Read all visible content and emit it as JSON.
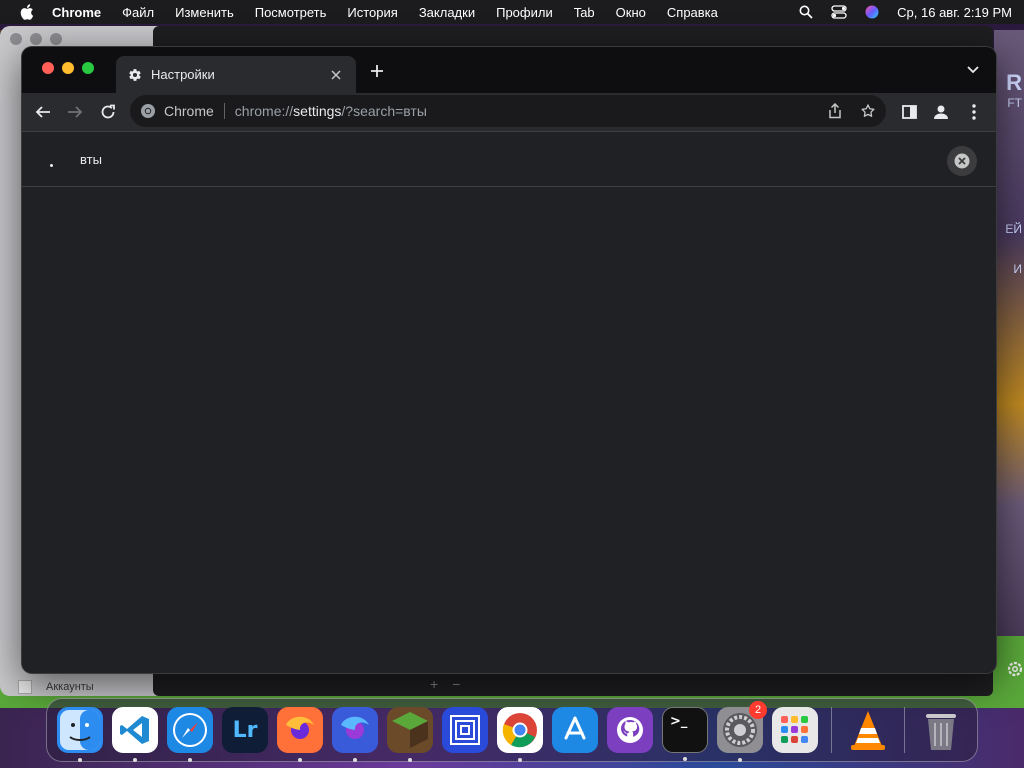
{
  "menubar": {
    "app": "Chrome",
    "items": [
      "Файл",
      "Изменить",
      "Посмотреть",
      "История",
      "Закладки",
      "Профили",
      "Tab",
      "Окно",
      "Справка"
    ],
    "clock": "Ср, 16 авг.  2:19 PM"
  },
  "background": {
    "status_text": "Аккаунты",
    "right_edge_texts": [
      "R",
      "FT",
      "ЕЙ",
      "И"
    ]
  },
  "chrome": {
    "tab": {
      "title": "Настройки",
      "icon": "gear-icon"
    },
    "omnibox": {
      "site_label": "Chrome",
      "url_prefix": "chrome://",
      "url_host": "settings",
      "url_suffix": "/?search=вты"
    },
    "settings_search": {
      "query": "вты"
    }
  },
  "dock": {
    "apps": [
      {
        "name": "finder",
        "label": "",
        "color": "#2d8cf0"
      },
      {
        "name": "vscode",
        "label": "",
        "color": "#ffffff"
      },
      {
        "name": "safari",
        "label": "",
        "color": "#1e88e5"
      },
      {
        "name": "lightroom",
        "label": "Lr",
        "color": "#0f1e36"
      },
      {
        "name": "firefox",
        "label": "",
        "color": "#ff7139"
      },
      {
        "name": "firefox-developer",
        "label": "",
        "color": "#3a5bd9"
      },
      {
        "name": "minecraft",
        "label": "",
        "color": "#6b4a2a"
      },
      {
        "name": "screen-app",
        "label": "",
        "color": "#2a4ad9"
      },
      {
        "name": "chrome",
        "label": "",
        "color": "#ffffff"
      },
      {
        "name": "app-store",
        "label": "",
        "color": "#1e88e5"
      },
      {
        "name": "github-desktop",
        "label": "",
        "color": "#7b3fbf"
      },
      {
        "name": "terminal",
        "label": ">_",
        "color": "#111111"
      },
      {
        "name": "system-settings",
        "label": "",
        "color": "#8e8e93",
        "badge": "2"
      },
      {
        "name": "launchpad",
        "label": "",
        "color": "#e8e8e8"
      },
      {
        "name": "vlc",
        "label": "",
        "color": "transparent"
      },
      {
        "name": "trash",
        "label": "",
        "color": "transparent"
      }
    ]
  }
}
